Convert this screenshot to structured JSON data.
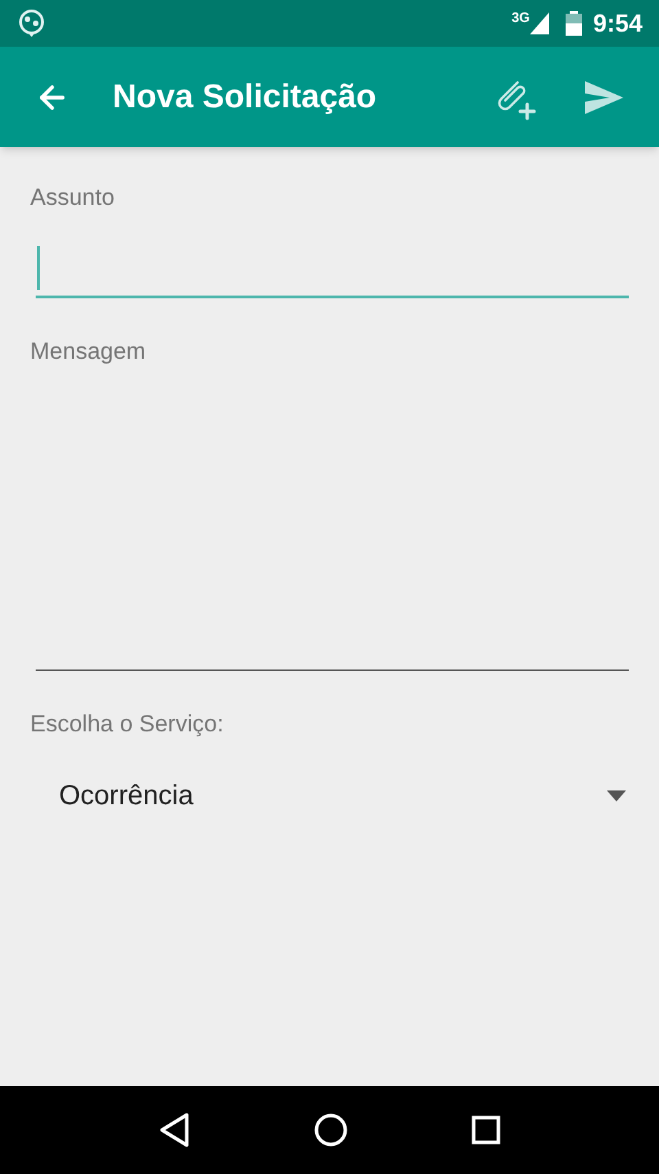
{
  "status_bar": {
    "network": "3G",
    "time": "9:54"
  },
  "app_bar": {
    "title": "Nova Solicitação"
  },
  "form": {
    "subject": {
      "label": "Assunto",
      "focused": true
    },
    "message": {
      "label": "Mensagem",
      "focused": false
    },
    "service": {
      "label": "Escolha o Serviço:",
      "value": "Ocorrência"
    }
  }
}
